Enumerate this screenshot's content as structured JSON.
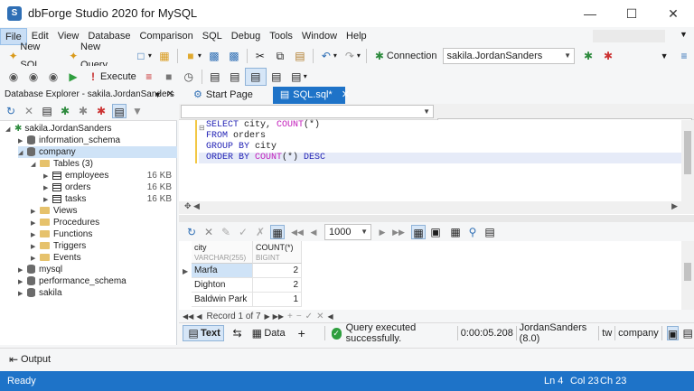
{
  "window": {
    "title": "dbForge Studio 2020 for MySQL",
    "app_icon": "S",
    "minimize_icon": "minimize-icon",
    "maximize_icon": "maximize-icon",
    "close_icon": "close-icon"
  },
  "menu": [
    {
      "label": "File"
    },
    {
      "label": "Edit"
    },
    {
      "label": "View"
    },
    {
      "label": "Database"
    },
    {
      "label": "Comparison"
    },
    {
      "label": "SQL"
    },
    {
      "label": "Debug"
    },
    {
      "label": "Tools"
    },
    {
      "label": "Window"
    },
    {
      "label": "Help"
    }
  ],
  "toolbar1": {
    "new_sql": "New SQL",
    "new_query": "New Query",
    "connection_label": "Connection",
    "connection_value": "sakila.JordanSanders"
  },
  "toolbar2": {
    "execute": "Execute"
  },
  "explorer": {
    "title": "Database Explorer - sakila.JordanSanders",
    "pin_icon": "pin-icon",
    "tree": [
      {
        "label": "sakila.JordanSanders"
      },
      {
        "label": "information_schema"
      },
      {
        "label": "company"
      },
      {
        "label": "Tables (3)"
      },
      {
        "label": "employees",
        "size": "16 KB"
      },
      {
        "label": "orders",
        "size": "16 KB"
      },
      {
        "label": "tasks",
        "size": "16 KB"
      },
      {
        "label": "Views"
      },
      {
        "label": "Procedures"
      },
      {
        "label": "Functions"
      },
      {
        "label": "Triggers"
      },
      {
        "label": "Events"
      },
      {
        "label": "mysql"
      },
      {
        "label": "performance_schema"
      },
      {
        "label": "sakila"
      }
    ]
  },
  "tabs": [
    {
      "label": "Start Page"
    },
    {
      "label": "SQL.sql*"
    }
  ],
  "editor": {
    "lines": [
      {
        "kw1": "SELECT ",
        "t1": "city, ",
        "fn": "COUNT",
        "t2": "(*)"
      },
      {
        "kw1": "FROM ",
        "t1": "orders"
      },
      {
        "kw1": "GROUP BY ",
        "t1": "city"
      },
      {
        "kw1": "ORDER BY ",
        "fn": "COUNT",
        "t2": "(*) ",
        "kw2": "DESC"
      }
    ]
  },
  "results": {
    "page_size": "1000",
    "columns": [
      {
        "name": "city",
        "type": "VARCHAR(255)"
      },
      {
        "name": "COUNT(*)",
        "type": "BIGINT"
      }
    ],
    "rows": [
      {
        "city": "Marfa",
        "count": "2"
      },
      {
        "city": "Dighton",
        "count": "2"
      },
      {
        "city": "Baldwin Park",
        "count": "1"
      }
    ],
    "record_text": "Record 1 of 7"
  },
  "result_tabs": {
    "text": "Text",
    "data": "Data",
    "add": "+"
  },
  "query_status": {
    "message": "Query executed successfully.",
    "duration": "0:00:05.208",
    "user": "JordanSanders (8.0)",
    "db1": "tw",
    "db2": "company"
  },
  "output": {
    "label": "Output"
  },
  "status": {
    "ready": "Ready",
    "ln": "Ln 4",
    "col": "Col 23",
    "ch": "Ch 23"
  },
  "colors": {
    "accent": "#1e73c8",
    "keyword": "#1f1fb4",
    "function": "#c21cba",
    "success": "#2e9e3e"
  }
}
